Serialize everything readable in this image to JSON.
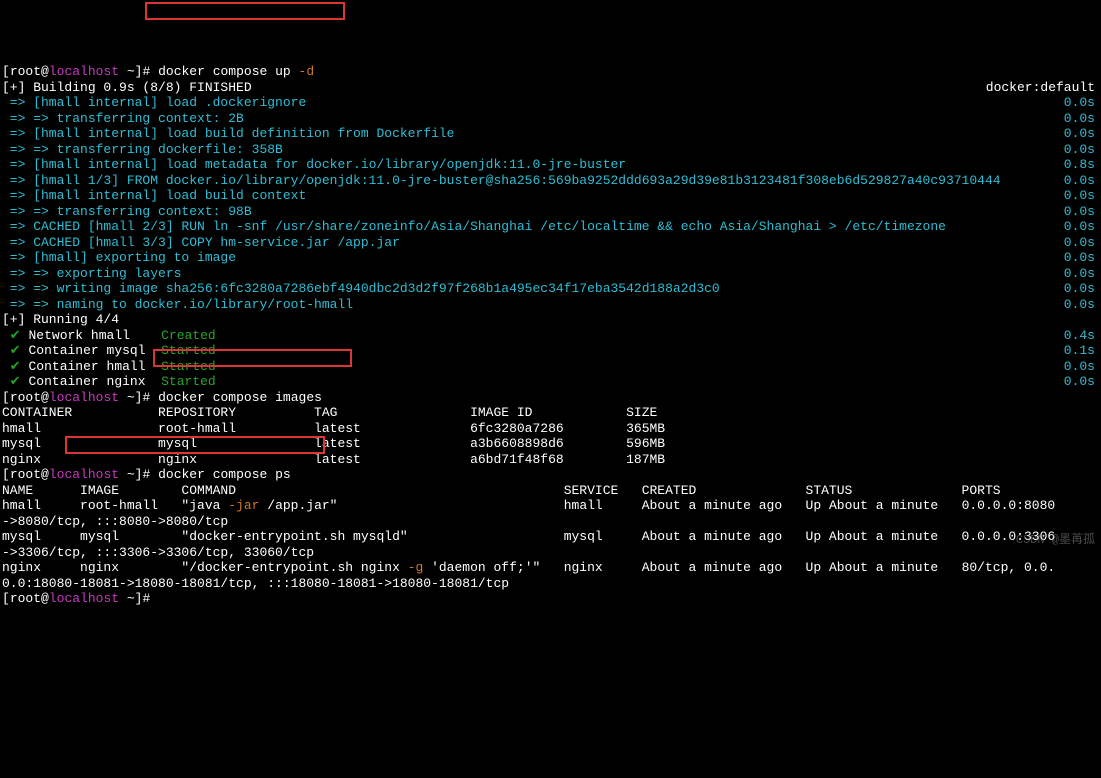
{
  "prompts": {
    "lbracket": "[",
    "rbracket": "]",
    "root": "root",
    "at": "@",
    "host": "localhost",
    "tilde": " ~",
    "hash": "# "
  },
  "cmd1": "docker compose up ",
  "cmd1_flag": "-d",
  "cmd2": "docker compose images",
  "cmd3": "docker compose ps",
  "build_header": "[+] Building 0.9s (8/8) FINISHED",
  "build_right": "docker:default",
  "arrows": {
    "a": " => ",
    "b": " => => "
  },
  "build_steps": [
    {
      "text": "[hmall internal] load .dockerignore",
      "time": "0.0s",
      "indent": "a"
    },
    {
      "text": "transferring context: 2B",
      "time": "0.0s",
      "indent": "b"
    },
    {
      "text": "[hmall internal] load build definition from Dockerfile",
      "time": "0.0s",
      "indent": "a"
    },
    {
      "text": "transferring dockerfile: 358B",
      "time": "0.0s",
      "indent": "b"
    },
    {
      "text": "[hmall internal] load metadata for docker.io/library/openjdk:11.0-jre-buster",
      "time": "0.8s",
      "indent": "a"
    },
    {
      "text": "[hmall 1/3] FROM docker.io/library/openjdk:11.0-jre-buster@sha256:569ba9252ddd693a29d39e81b3123481f308eb6d529827a40c93710444",
      "time": "0.0s",
      "indent": "a"
    },
    {
      "text": "[hmall internal] load build context",
      "time": "0.0s",
      "indent": "a"
    },
    {
      "text": "transferring context: 98B",
      "time": "0.0s",
      "indent": "b"
    },
    {
      "text": "CACHED [hmall 2/3] RUN ln -snf /usr/share/zoneinfo/Asia/Shanghai /etc/localtime && echo Asia/Shanghai > /etc/timezone",
      "time": "0.0s",
      "indent": "a"
    },
    {
      "text": "CACHED [hmall 3/3] COPY hm-service.jar /app.jar",
      "time": "0.0s",
      "indent": "a"
    },
    {
      "text": "[hmall] exporting to image",
      "time": "0.0s",
      "indent": "a"
    },
    {
      "text": "exporting layers",
      "time": "0.0s",
      "indent": "b"
    },
    {
      "text": "writing image sha256:6fc3280a7286ebf4940dbc2d3d2f97f268b1a495ec34f17eba3542d188a2d3c0",
      "time": "0.0s",
      "indent": "b"
    },
    {
      "text": "naming to docker.io/library/root-hmall",
      "time": "0.0s",
      "indent": "b"
    }
  ],
  "running_header": "[+] Running 4/4",
  "check": " ✔ ",
  "running_items": [
    {
      "name": "Network hmall    ",
      "status": "Created",
      "time": "0.4s"
    },
    {
      "name": "Container mysql  ",
      "status": "Started",
      "time": "0.1s"
    },
    {
      "name": "Container hmall  ",
      "status": "Started",
      "time": "0.0s"
    },
    {
      "name": "Container nginx  ",
      "status": "Started",
      "time": "0.0s"
    }
  ],
  "images_header": "CONTAINER           REPOSITORY          TAG                 IMAGE ID            SIZE",
  "images_rows": [
    "hmall               root-hmall          latest              6fc3280a7286        365MB",
    "mysql               mysql               latest              a3b6608898d6        596MB",
    "nginx               nginx               latest              a6bd71f48f68        187MB"
  ],
  "ps_header": "NAME      IMAGE        COMMAND                                          SERVICE   CREATED              STATUS              PORTS",
  "ps_rows": [
    {
      "pre": "hmall     root-hmall   \"java ",
      "cmd": "-jar",
      "post": " /app.jar\"                             hmall     About a minute ago   Up About a minute   0.0.0.0:8080"
    },
    {
      "wrap": "->8080/tcp, :::8080->8080/tcp"
    },
    {
      "plain": "mysql     mysql        \"docker-entrypoint.sh mysqld\"                    mysql     About a minute ago   Up About a minute   0.0.0.0:3306"
    },
    {
      "wrap": "->3306/tcp, :::3306->3306/tcp, 33060/tcp"
    },
    {
      "pre": "nginx     nginx        \"/docker-entrypoint.sh nginx ",
      "cmd": "-g",
      "post": " 'daemon off;'\"   nginx     About a minute ago   Up About a minute   80/tcp, 0.0."
    },
    {
      "wrap": "0.0:18080-18081->18080-18081/tcp, :::18080-18081->18080-18081/tcp"
    }
  ],
  "watermark": "CSDN @墨苒孤"
}
